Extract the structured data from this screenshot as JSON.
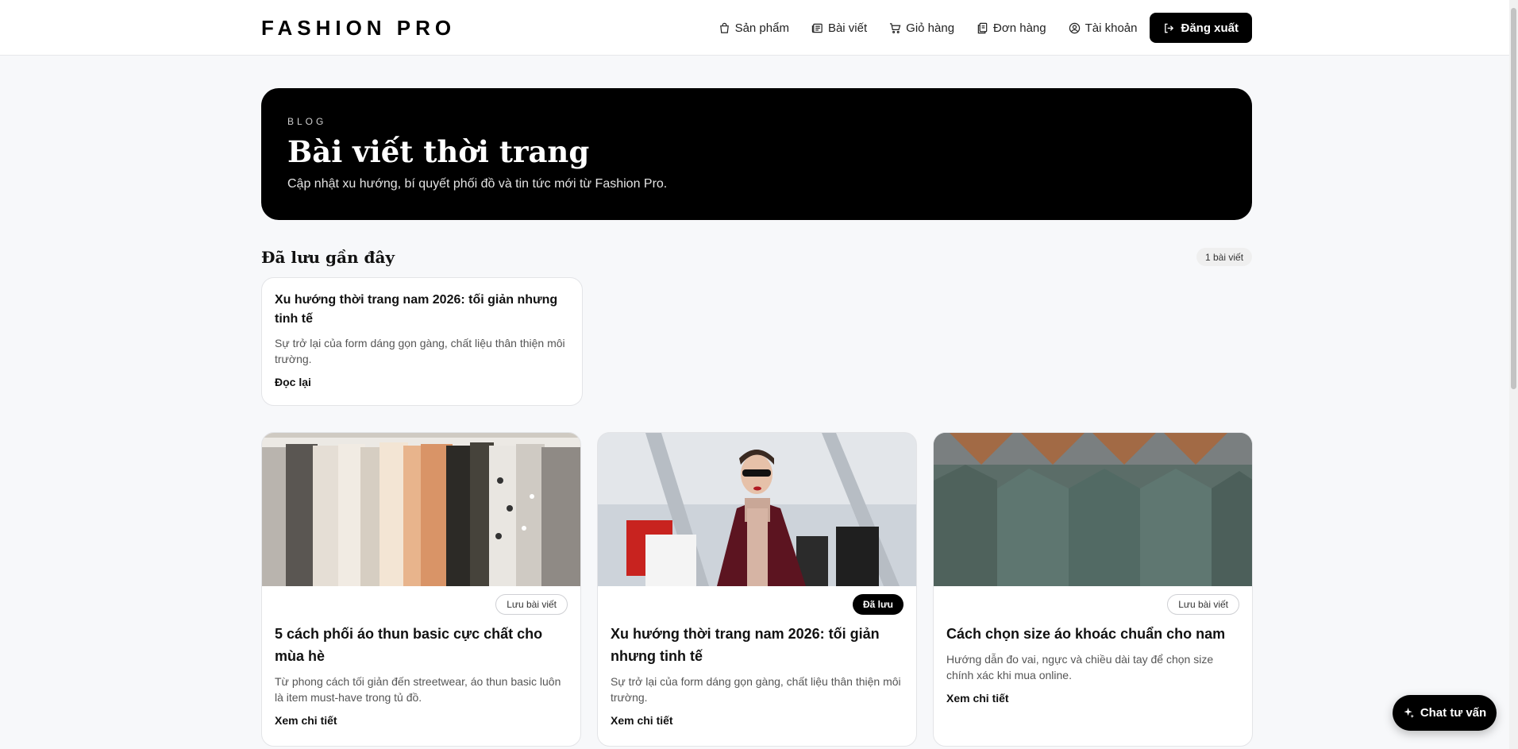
{
  "brand": {
    "name": "FASHION PRO"
  },
  "nav": {
    "items": [
      {
        "label": "Sản phẩm",
        "icon": "bag-icon"
      },
      {
        "label": "Bài viết",
        "icon": "newspaper-icon"
      },
      {
        "label": "Giỏ hàng",
        "icon": "cart-icon"
      },
      {
        "label": "Đơn hàng",
        "icon": "orders-icon"
      },
      {
        "label": "Tài khoản",
        "icon": "user-icon"
      }
    ],
    "logout_label": "Đăng xuất"
  },
  "hero": {
    "eyebrow": "BLOG",
    "title": "Bài viết thời trang",
    "description": "Cập nhật xu hướng, bí quyết phối đồ và tin tức mới từ Fashion Pro."
  },
  "saved": {
    "title": "Đã lưu gần đây",
    "count": "1 bài viết",
    "items": [
      {
        "title": "Xu hướng thời trang nam 2026: tối giản nhưng tinh tế",
        "excerpt": "Sự trở lại của form dáng gọn gàng, chất liệu thân thiện môi trường.",
        "link": "Đọc lại"
      }
    ]
  },
  "articles": [
    {
      "badge": "Lưu bài viết",
      "badge_style": "outline",
      "title": "5 cách phối áo thun basic cực chất cho mùa hè",
      "excerpt": "Từ phong cách tối giản đến streetwear, áo thun basic luôn là item must-have trong tủ đồ.",
      "link": "Xem chi tiết"
    },
    {
      "badge": "Đã lưu",
      "badge_style": "solid",
      "title": "Xu hướng thời trang nam 2026: tối giản nhưng tinh tế",
      "excerpt": "Sự trở lại của form dáng gọn gàng, chất liệu thân thiện môi trường.",
      "link": "Xem chi tiết"
    },
    {
      "badge": "Lưu bài viết",
      "badge_style": "outline",
      "title": "Cách chọn size áo khoác chuẩn cho nam",
      "excerpt": "Hướng dẫn đo vai, ngực và chiều dài tay để chọn size chính xác khi mua online.",
      "link": "Xem chi tiết"
    }
  ],
  "chat": {
    "label": "Chat tư vấn"
  },
  "colors": {
    "primary": "#000000",
    "background": "#f7f8fa",
    "card": "#ffffff",
    "border": "#e3e4e7"
  }
}
